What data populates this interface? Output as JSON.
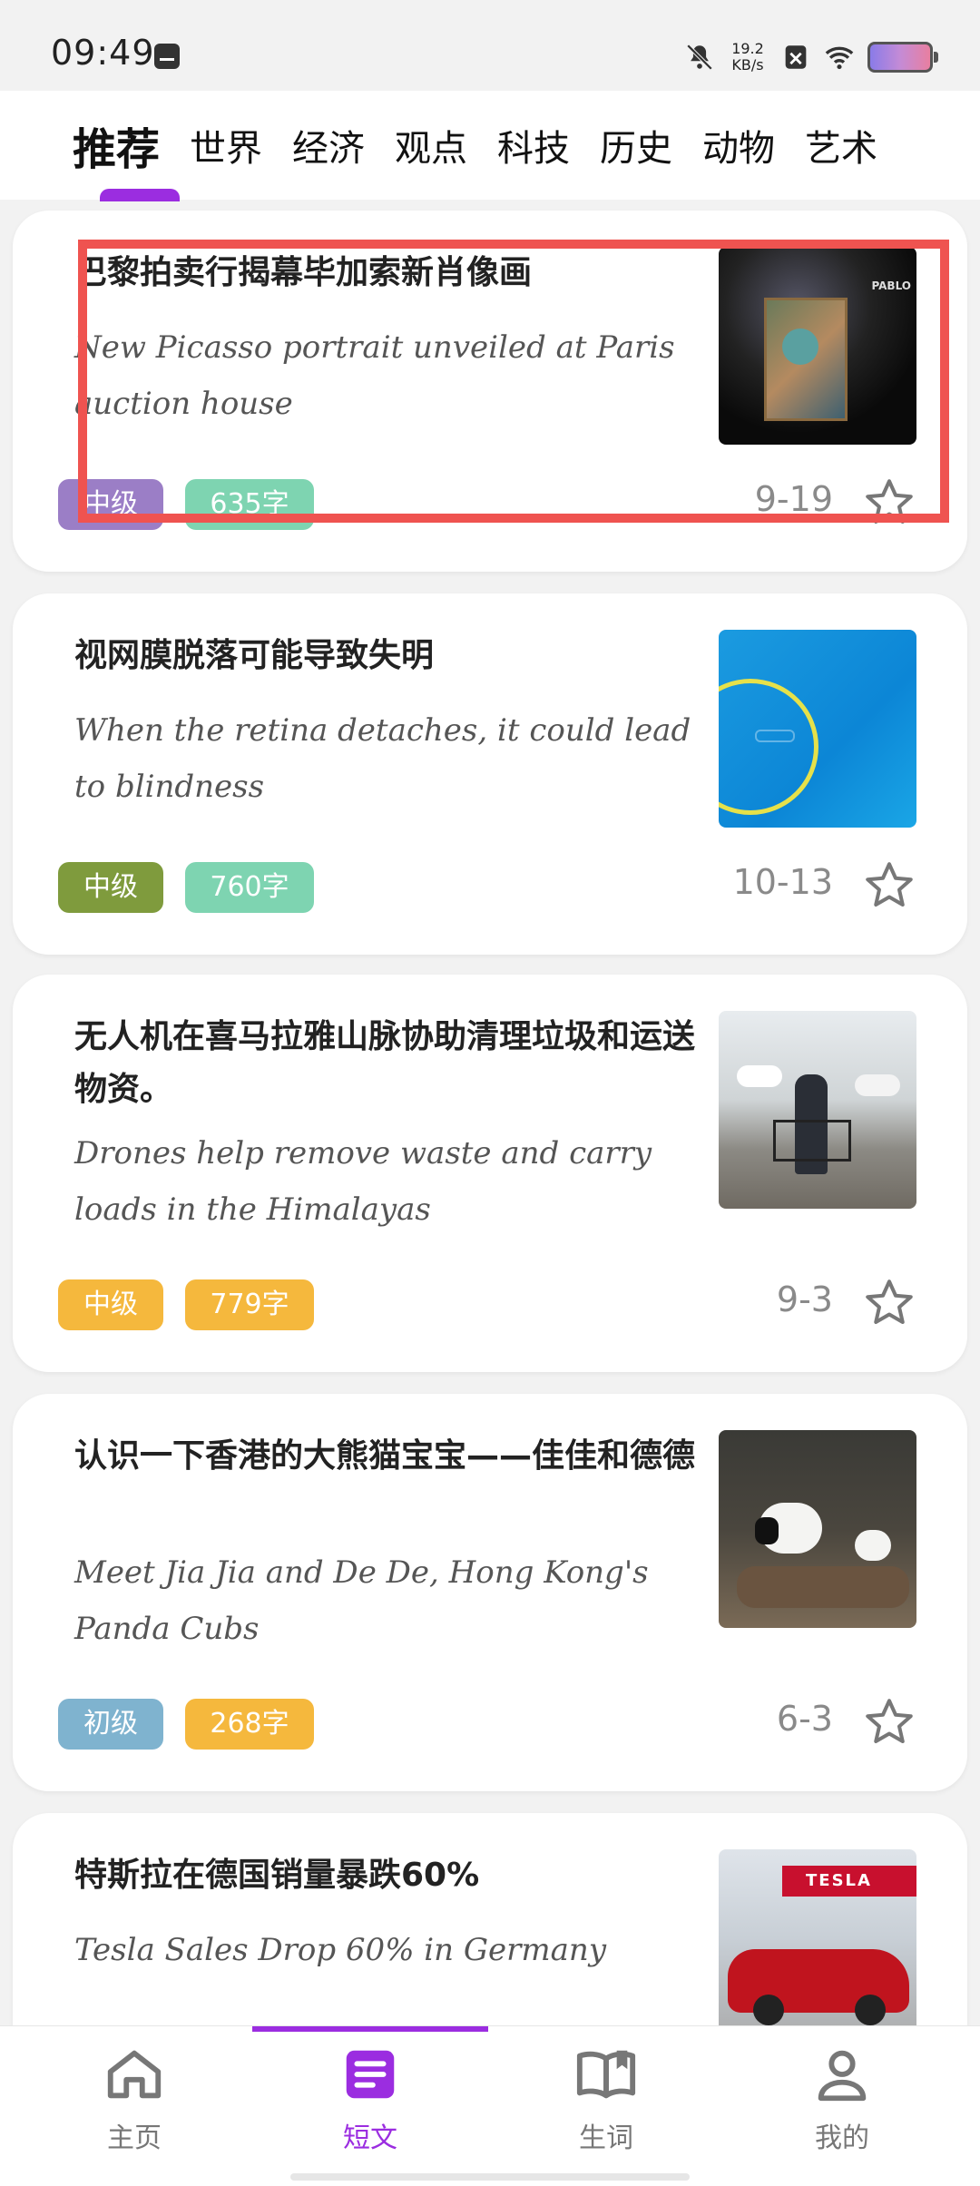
{
  "status_bar": {
    "time": "09:49",
    "net_speed_value": "19.2",
    "net_speed_unit": "KB/s"
  },
  "tabs": [
    {
      "label": "推荐",
      "active": true
    },
    {
      "label": "世界"
    },
    {
      "label": "经济"
    },
    {
      "label": "观点"
    },
    {
      "label": "科技"
    },
    {
      "label": "历史"
    },
    {
      "label": "动物"
    },
    {
      "label": "艺术"
    }
  ],
  "articles": [
    {
      "title": "巴黎拍卖行揭幕毕加索新肖像画",
      "subtitle": "New Picasso portrait unveiled at Paris auction house",
      "level": "中级",
      "words": "635字",
      "date": "9-19",
      "level_color": "#9b7ec6",
      "words_color": "#7ed4b1",
      "thumb_text": "PABLO",
      "image_icon": "picasso-portrait-image"
    },
    {
      "title": "视网膜脱落可能导致失明",
      "subtitle": "When the retina detaches, it could lead to blindness",
      "level": "中级",
      "words": "760字",
      "date": "10-13",
      "level_color": "#7f9b3d",
      "words_color": "#7ed4b1",
      "image_icon": "retina-microscope-image"
    },
    {
      "title": "无人机在喜马拉雅山脉协助清理垃圾和运送物资。",
      "subtitle": "Drones help remove waste and carry loads in the Himalayas",
      "level": "中级",
      "words": "779字",
      "date": "9-3",
      "level_color": "#f5b83d",
      "words_color": "#f5b83d",
      "image_icon": "himalaya-drone-image"
    },
    {
      "title": "认识一下香港的大熊猫宝宝——佳佳和德德",
      "subtitle": "Meet Jia Jia and De De, Hong Kong's Panda Cubs",
      "level": "初级",
      "words": "268字",
      "date": "6-3",
      "level_color": "#7fb3cf",
      "words_color": "#f5b83d",
      "image_icon": "panda-cubs-image"
    },
    {
      "title": "特斯拉在德国销量暴跌60%",
      "subtitle": "Tesla Sales Drop 60% in Germany",
      "thumb_text": "TESLA",
      "image_icon": "tesla-car-image"
    }
  ],
  "bottom_nav": [
    {
      "label": "主页",
      "icon": "home-icon"
    },
    {
      "label": "短文",
      "icon": "article-icon",
      "active": true
    },
    {
      "label": "生词",
      "icon": "book-icon"
    },
    {
      "label": "我的",
      "icon": "profile-icon"
    }
  ],
  "colors": {
    "accent": "#9b2de0",
    "highlight": "#ef5350"
  }
}
